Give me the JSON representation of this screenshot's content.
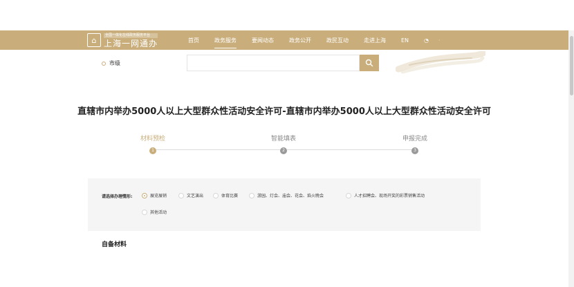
{
  "header": {
    "logo_small": "全国一体化在线政务服务平台",
    "logo_main": "上海一网通办",
    "nav": [
      "首页",
      "政务服务",
      "要闻动态",
      "政务公开",
      "政民互动",
      "走进上海",
      "EN"
    ],
    "active_nav": "政务服务"
  },
  "location": {
    "label": "市级"
  },
  "search": {
    "placeholder": ""
  },
  "page_title": "直辖市内举办5000人以上大型群众性活动安全许可-直辖市内举办5000人以上大型群众性活动安全许可",
  "steps": [
    {
      "label": "材料预检",
      "num": "1",
      "active": true
    },
    {
      "label": "智能填表",
      "num": "2",
      "active": false
    },
    {
      "label": "申报完成",
      "num": "3",
      "active": false
    }
  ],
  "options": {
    "label": "请选择办理情形:",
    "items": [
      {
        "label": "展览展销",
        "checked": true
      },
      {
        "label": "文艺演出",
        "checked": false
      },
      {
        "label": "体育比赛",
        "checked": false
      },
      {
        "label": "游园、灯会、庙会、花会、焰火晚会",
        "checked": false
      },
      {
        "label": "人才招聘会、现场开奖的彩票销售活动",
        "checked": false
      },
      {
        "label": "其他活动",
        "checked": false
      }
    ]
  },
  "section": {
    "title": "自备材料"
  },
  "colors": {
    "accent": "#c9ae7c"
  }
}
